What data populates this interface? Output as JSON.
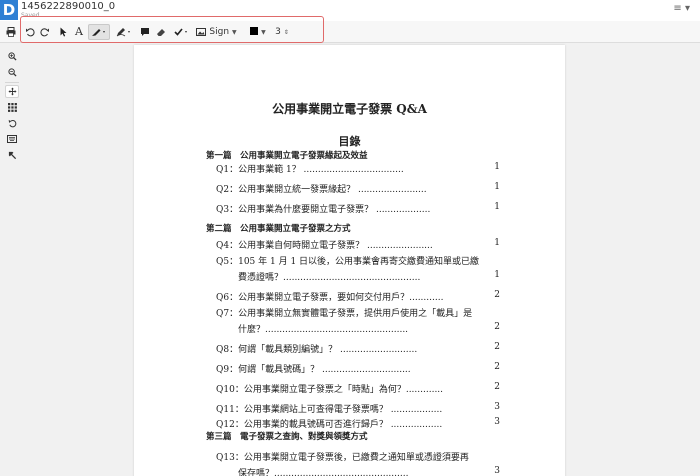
{
  "header": {
    "logo_letter": "D",
    "doc_title": "1456222890010_0",
    "status": "Saved",
    "menu_icon": "≡ ▾"
  },
  "toolbar": {
    "sign_label": "Sign",
    "line_width": "3",
    "color": "#000000"
  },
  "document": {
    "title": "公用事業開立電子發票 Q&A",
    "toc_heading": "目錄",
    "entries": [
      {
        "kind": "part",
        "text": "第一篇　公用事業開立電子發票緣起及效益"
      },
      {
        "kind": "q",
        "text": "Q1：公用事業範 1？ ...................................",
        "page": "1"
      },
      {
        "kind": "q",
        "text": "Q2：公用事業開立統一發票緣起？ ........................",
        "page": "1"
      },
      {
        "kind": "q",
        "text": "Q3：公用事業為什麼要開立電子發票？ ...................",
        "page": "1"
      },
      {
        "kind": "part",
        "text": "第二篇　公用事業開立電子發票之方式"
      },
      {
        "kind": "q",
        "text": "Q4：公用事業自何時開立電子發票？ .......................",
        "page": "1"
      },
      {
        "kind": "q",
        "text": "Q5：105 年 1 月 1 日以後，公用事業會再寄交繳費通知單或已繳",
        "page": ""
      },
      {
        "kind": "cont",
        "text": "費憑證嗎？................................................",
        "page": "1"
      },
      {
        "kind": "q",
        "text": "Q6：公用事業開立電子發票，要如何交付用戶？............",
        "page": "2"
      },
      {
        "kind": "q",
        "text": "Q7：公用事業開立無實體電子發票，提供用戶使用之「載具」是",
        "page": ""
      },
      {
        "kind": "cont",
        "text": "什麼？..................................................",
        "page": "2"
      },
      {
        "kind": "q",
        "text": "Q8：何謂「載具類別編號」？ ...........................",
        "page": "2"
      },
      {
        "kind": "q",
        "text": "Q9：何謂「載具號碼」？ ...............................",
        "page": "2"
      },
      {
        "kind": "q",
        "text": "Q10：公用事業開立電子發票之「時點」為何？.............",
        "page": "2"
      },
      {
        "kind": "q",
        "text": "Q11：公用事業網站上可查得電子發票嗎？ ..................",
        "page": "3"
      },
      {
        "kind": "q",
        "text": "Q12：公用事業的載具號碼可否進行歸戶？ ..................",
        "page": "3"
      },
      {
        "kind": "part",
        "text": "第三篇　電子發票之查詢、對獎與領獎方式"
      },
      {
        "kind": "q",
        "text": "Q13：公用事業開立電子發票後，已繳費之通知單或憑證須要再",
        "page": ""
      },
      {
        "kind": "cont",
        "text": "保存嗎？...............................................",
        "page": "3"
      }
    ]
  }
}
